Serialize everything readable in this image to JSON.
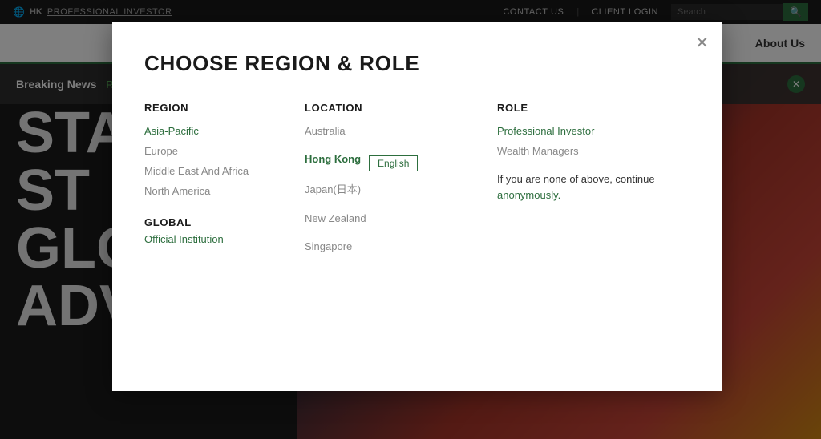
{
  "topNav": {
    "globeIcon": "🌐",
    "regionCode": "HK",
    "profInvestorLabel": "PROFESSIONAL INVESTOR",
    "contactUs": "CONTACT US",
    "clientLogin": "CLIENT LOGIN",
    "searchPlaceholder": "Search",
    "searchIcon": "🔍"
  },
  "secNav": {
    "aboutUs": "About Us"
  },
  "breakingNews": {
    "title": "Breaking News",
    "readMore": "Read more",
    "closeIcon": "✕"
  },
  "bgContent": {
    "line1": "STA",
    "line2": "ST",
    "line3": "GLOB",
    "line4": "ADVISORS"
  },
  "modal": {
    "closeIcon": "✕",
    "title": "Choose Region & Role",
    "region": {
      "header": "REGION",
      "items": [
        {
          "label": "Asia-Pacific",
          "active": true
        },
        {
          "label": "Europe",
          "active": false
        },
        {
          "label": "Middle East And Africa",
          "active": false
        },
        {
          "label": "North America",
          "active": false
        }
      ],
      "globalHeader": "GLOBAL",
      "officialInstitution": "Official Institution"
    },
    "location": {
      "header": "LOCATION",
      "items": [
        {
          "label": "Australia",
          "active": false
        },
        {
          "label": "Hong Kong",
          "active": true
        },
        {
          "label": "Japan(日本)",
          "active": false
        },
        {
          "label": "New Zealand",
          "active": false
        },
        {
          "label": "Singapore",
          "active": false
        }
      ],
      "languageButton": "English"
    },
    "role": {
      "header": "ROLE",
      "items": [
        {
          "label": "Professional Investor",
          "active": true
        },
        {
          "label": "Wealth Managers",
          "active": false
        }
      ],
      "anonText": "If you are none of above, continue",
      "anonLink": "anonymously."
    }
  }
}
